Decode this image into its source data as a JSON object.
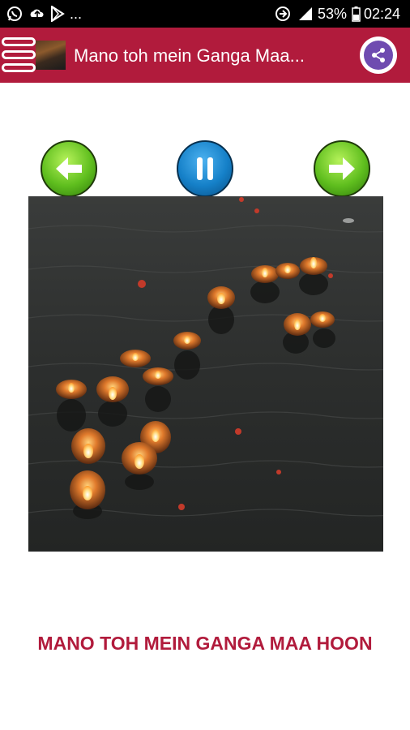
{
  "status_bar": {
    "icons": [
      "whatsapp-icon",
      "cloud-upload-icon",
      "play-store-icon",
      "sync-icon",
      "signal-icon",
      "battery-icon"
    ],
    "overflow": "...",
    "battery": "53%",
    "time": "02:24"
  },
  "app_bar": {
    "title": "Mano toh mein Ganga Maa...",
    "color": "#b11b3c",
    "share_icon": "share-icon",
    "menu_icon": "menu-icon"
  },
  "controls": {
    "prev_icon": "arrow-left-icon",
    "pause_icon": "pause-icon",
    "next_icon": "arrow-right-icon"
  },
  "content": {
    "image_subject": "floating diyas on dark water",
    "caption": "MANO TOH MEIN GANGA MAA HOON",
    "caption_color": "#b11b3c"
  }
}
